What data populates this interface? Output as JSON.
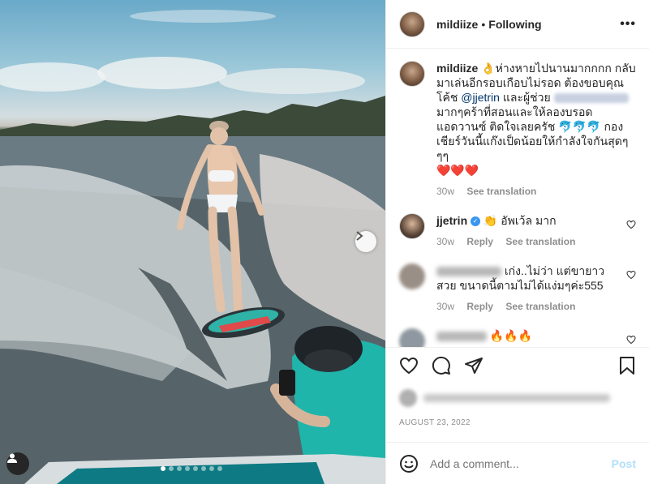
{
  "post": {
    "username": "mildiize",
    "follow_status": "Following",
    "more_label": "•••",
    "date": "AUGUST 23, 2022",
    "carousel_count": 8,
    "carousel_active_index": 0
  },
  "caption": {
    "username": "mildiize",
    "text_part1": "👌ห่างหายไปนานมากกกก กลับมาเล่นอีกรอบเกือบไม่รอด ต้องขอบคุณโค้ช",
    "mention": "@jjetrin",
    "text_part2": "และผู้ช่วย",
    "text_part3": "มากๆคร้าที่สอนและให้ลองบรอดแอดวานซ์ ติดใจเลยครัช 🐬🐬🐬 กองเชียร์วันนี้แก๊งเป็ดน้อยให้กำลังใจกันสุดๆๆๆ",
    "hearts": "❤️❤️❤️",
    "time": "30w",
    "see_translation": "See translation"
  },
  "comments": [
    {
      "username": "jjetrin",
      "verified": true,
      "text": "👏 อัพเว้ล มาก",
      "time": "30w",
      "reply": "Reply",
      "see_translation": "See translation"
    },
    {
      "text": "เก่ง..ไม่ว่า แต่ขายาวสวย ขนาดนี้ตามไม่ได้แง่มๆค่ะ555",
      "time": "30w",
      "reply": "Reply",
      "see_translation": "See translation"
    },
    {
      "text": "🔥🔥🔥"
    }
  ],
  "add_comment": {
    "placeholder": "Add a comment...",
    "post_label": "Post"
  },
  "colors": {
    "link": "#00376b",
    "verified": "#3897f0",
    "heart": "#ed4956",
    "post_disabled": "#b2dffc"
  }
}
